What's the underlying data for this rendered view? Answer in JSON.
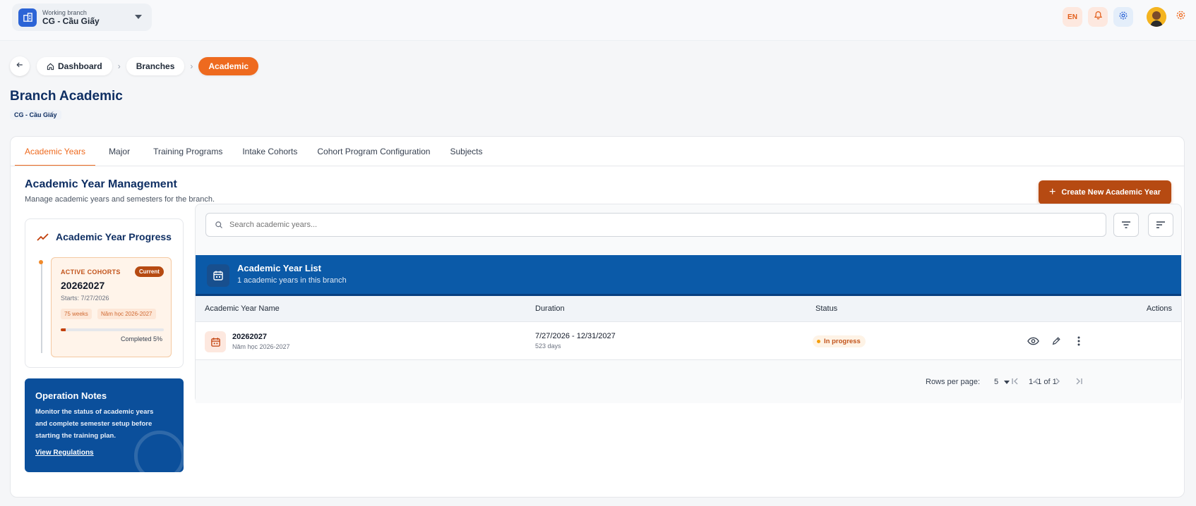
{
  "topbar": {
    "branch_label": "Working branch",
    "branch_name": "CG - Cầu Giấy",
    "language": "EN",
    "icons": [
      "building-icon",
      "bell-icon",
      "gear-icon",
      "avatar",
      "gear-icon"
    ]
  },
  "breadcrumb": {
    "items": [
      "Dashboard",
      "Branches",
      "Academic"
    ]
  },
  "page": {
    "title": "Branch Academic",
    "branch_chip": "CG - Cầu Giấy"
  },
  "tabs": [
    "Academic Years",
    "Major",
    "Training Programs",
    "Intake Cohorts",
    "Cohort Program Configuration",
    "Subjects"
  ],
  "section": {
    "title": "Academic Year Management",
    "subtitle": "Manage academic years and semesters for the branch.",
    "create_button": "Create New Academic Year"
  },
  "progress": {
    "title": "Academic Year Progress",
    "cohort_label": "ACTIVE COHORTS",
    "current_badge": "Current",
    "year": "20262027",
    "starts": "Starts: 7/27/2026",
    "tag_weeks": "75 weeks",
    "tag_year": "Năm học 2026-2027",
    "completed_percent": 5,
    "completed_text": "Completed 5%"
  },
  "ops": {
    "title": "Operation Notes",
    "text": "Monitor the status of academic years and complete semester setup before starting the training plan.",
    "link": "View Regulations"
  },
  "list": {
    "search_placeholder": "Search academic years...",
    "title": "Academic Year List",
    "subtitle": "1 academic years in this branch",
    "columns": [
      "Academic Year Name",
      "Duration",
      "Status",
      "Actions"
    ],
    "rows": [
      {
        "name": "20262027",
        "name_sub": "Năm học 2026-2027",
        "duration": "7/27/2026 - 12/31/2027",
        "days": "523 days",
        "status": "In progress"
      }
    ],
    "rows_per_page_label": "Rows per page:",
    "rows_per_page": "5",
    "range": "1–1 of 1"
  },
  "colors": {
    "accent": "#ee6a1f",
    "primary_blue": "#0b5aa8",
    "navy": "#0f2f63",
    "button_dark_orange": "#b64a12"
  }
}
